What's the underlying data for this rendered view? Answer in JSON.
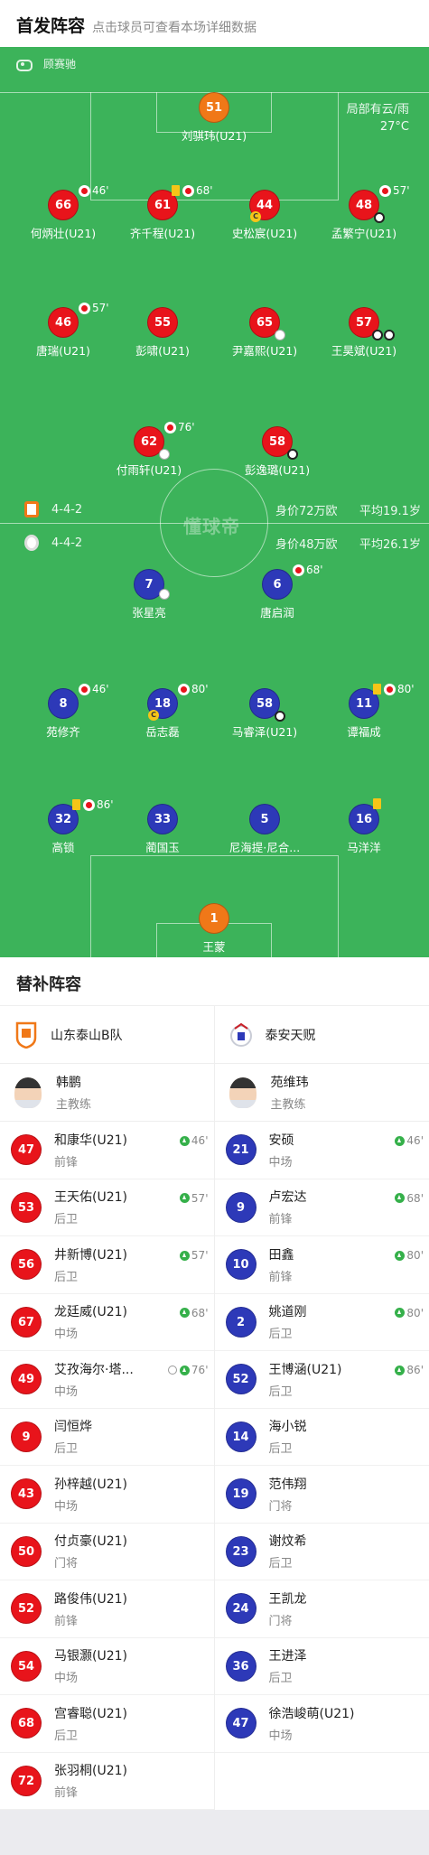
{
  "header": {
    "title": "首发阵容",
    "hint": "点击球员可查看本场详细数据"
  },
  "pitch": {
    "referee": "顾赛驰",
    "weather": {
      "condition": "局部有云/雨",
      "temperature": "27°C"
    },
    "watermark": "懂球帝",
    "home": {
      "formation": "4-4-2",
      "value": "身价72万欧",
      "avg_age": "平均19.1岁",
      "color": "#e8141b"
    },
    "away": {
      "formation": "4-4-2",
      "value": "身价48万欧",
      "avg_age": "平均26.1岁",
      "color": "#2d39b8"
    },
    "home_players": [
      {
        "num": "51",
        "name": "刘骐玮(U21)"
      },
      {
        "num": "66",
        "name": "何炳壮(U21)",
        "sub": "46'"
      },
      {
        "num": "61",
        "name": "齐千程(U21)",
        "sub": "68'"
      },
      {
        "num": "44",
        "name": "史松宸(U21)"
      },
      {
        "num": "48",
        "name": "孟繁宁(U21)",
        "sub": "57'"
      },
      {
        "num": "46",
        "name": "唐瑞(U21)",
        "sub": "57'"
      },
      {
        "num": "55",
        "name": "彭啸(U21)"
      },
      {
        "num": "65",
        "name": "尹嘉熙(U21)"
      },
      {
        "num": "57",
        "name": "王昊斌(U21)"
      },
      {
        "num": "62",
        "name": "付雨轩(U21)",
        "sub": "76'"
      },
      {
        "num": "58",
        "name": "彭逸璐(U21)"
      }
    ],
    "away_players": [
      {
        "num": "7",
        "name": "张星亮"
      },
      {
        "num": "6",
        "name": "唐启润",
        "sub": "68'"
      },
      {
        "num": "8",
        "name": "苑修齐",
        "sub": "46'"
      },
      {
        "num": "18",
        "name": "岳志磊",
        "sub": "80'"
      },
      {
        "num": "58",
        "name": "马睿泽(U21)"
      },
      {
        "num": "11",
        "name": "谭福成",
        "sub": "80'"
      },
      {
        "num": "32",
        "name": "高锁",
        "sub": "86'"
      },
      {
        "num": "33",
        "name": "蔺国玉"
      },
      {
        "num": "5",
        "name": "尼海提·尼合..."
      },
      {
        "num": "16",
        "name": "马洋洋"
      },
      {
        "num": "1",
        "name": "王蒙"
      }
    ]
  },
  "subs": {
    "title": "替补阵容",
    "home": {
      "team": "山东泰山B队",
      "coach": {
        "name": "韩鹏",
        "role": "主教练"
      },
      "players": [
        {
          "num": "47",
          "name": "和康华(U21)",
          "pos": "前锋",
          "on": "46'"
        },
        {
          "num": "53",
          "name": "王天佑(U21)",
          "pos": "后卫",
          "on": "57'"
        },
        {
          "num": "56",
          "name": "井新博(U21)",
          "pos": "后卫",
          "on": "57'"
        },
        {
          "num": "67",
          "name": "龙廷威(U21)",
          "pos": "中场",
          "on": "68'"
        },
        {
          "num": "49",
          "name": "艾孜海尔·塔...",
          "pos": "中场",
          "on": "76'"
        },
        {
          "num": "9",
          "name": "闫恒烨",
          "pos": "后卫"
        },
        {
          "num": "43",
          "name": "孙梓越(U21)",
          "pos": "中场"
        },
        {
          "num": "50",
          "name": "付贞豪(U21)",
          "pos": "门将"
        },
        {
          "num": "52",
          "name": "路俊伟(U21)",
          "pos": "前锋"
        },
        {
          "num": "54",
          "name": "马银灏(U21)",
          "pos": "中场"
        },
        {
          "num": "68",
          "name": "宫睿聪(U21)",
          "pos": "后卫"
        },
        {
          "num": "72",
          "name": "张羽桐(U21)",
          "pos": "前锋"
        }
      ]
    },
    "away": {
      "team": "泰安天贶",
      "coach": {
        "name": "苑维玮",
        "role": "主教练"
      },
      "players": [
        {
          "num": "21",
          "name": "安硕",
          "pos": "中场",
          "on": "46'"
        },
        {
          "num": "9",
          "name": "卢宏达",
          "pos": "前锋",
          "on": "68'"
        },
        {
          "num": "10",
          "name": "田鑫",
          "pos": "前锋",
          "on": "80'"
        },
        {
          "num": "2",
          "name": "姚道刚",
          "pos": "后卫",
          "on": "80'"
        },
        {
          "num": "52",
          "name": "王博涵(U21)",
          "pos": "后卫",
          "on": "86'"
        },
        {
          "num": "14",
          "name": "海小锐",
          "pos": "后卫"
        },
        {
          "num": "19",
          "name": "范伟翔",
          "pos": "门将"
        },
        {
          "num": "23",
          "name": "谢炆希",
          "pos": "后卫"
        },
        {
          "num": "24",
          "name": "王凯龙",
          "pos": "门将"
        },
        {
          "num": "36",
          "name": "王进泽",
          "pos": "后卫"
        },
        {
          "num": "47",
          "name": "徐浩峻萌(U21)",
          "pos": "中场"
        }
      ]
    }
  }
}
